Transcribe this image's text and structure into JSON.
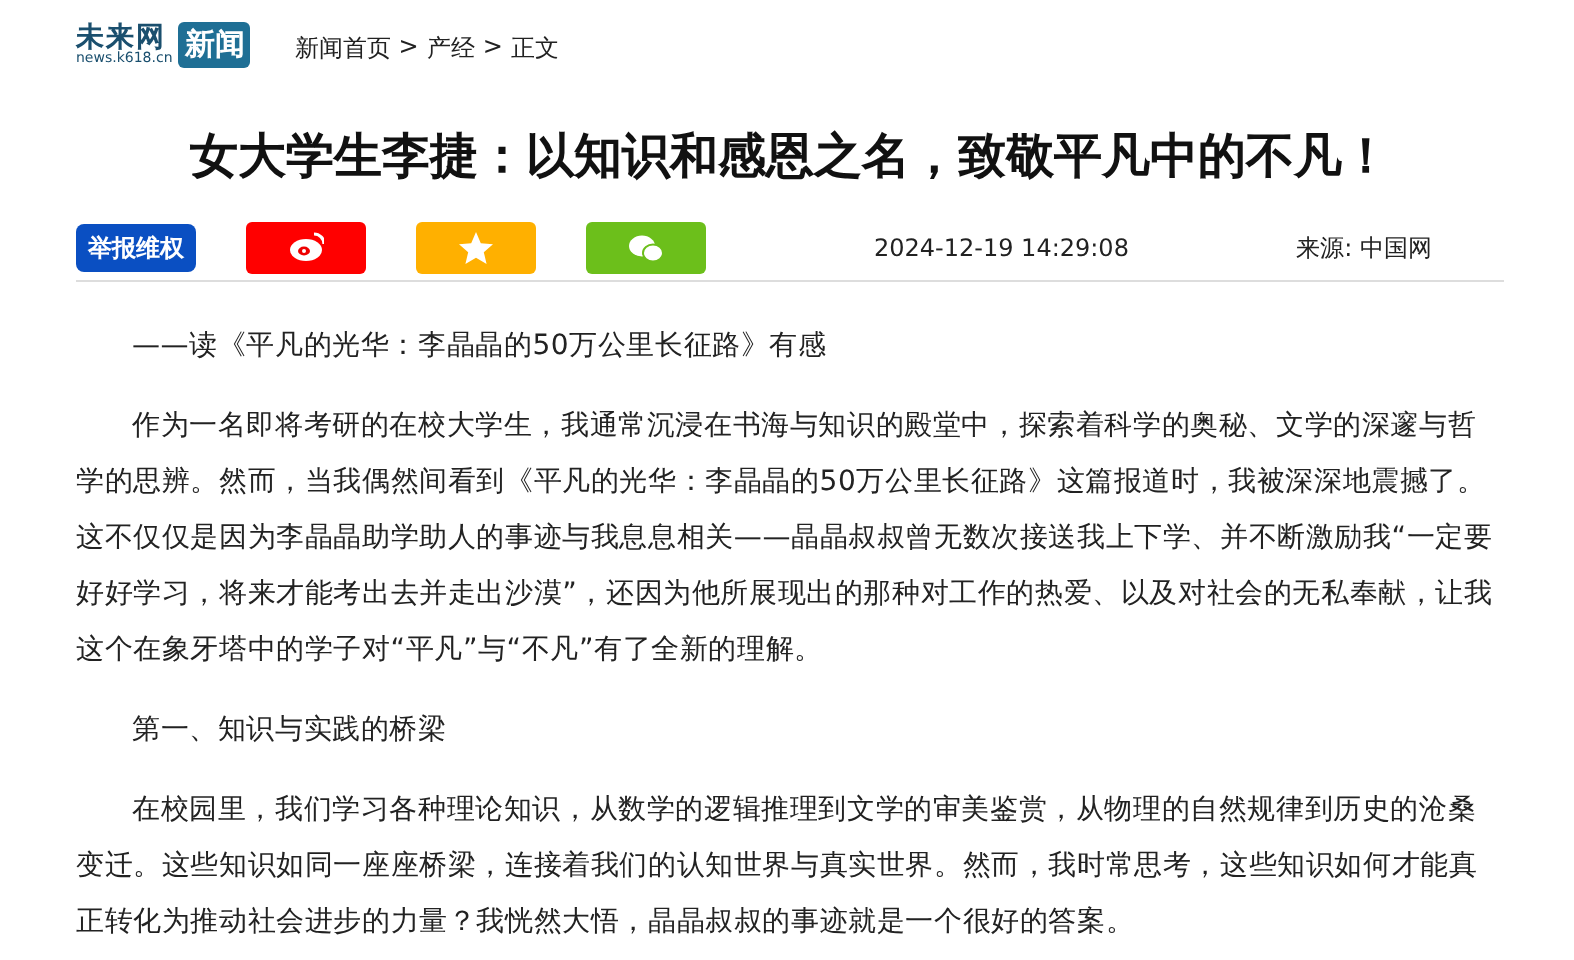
{
  "header": {
    "logo": {
      "name": "未来网",
      "domain": "news.k618.cn",
      "badge": "新闻"
    },
    "breadcrumb": [
      "新闻首页",
      ">",
      "产经",
      ">",
      "正文"
    ]
  },
  "article": {
    "title": "女大学生李捷：以知识和感恩之名，致敬平凡中的不凡！",
    "report_button": "举报维权",
    "share_buttons": [
      {
        "kind": "weibo",
        "color": "#ff0000"
      },
      {
        "kind": "favorite",
        "color": "#ffb000"
      },
      {
        "kind": "wechat",
        "color": "#6cbf1b"
      }
    ],
    "date": "2024-12-19 14:29:08",
    "source": "来源: 中国网",
    "paragraphs": [
      "——读《平凡的光华：李晶晶的50万公里长征路》有感",
      "作为一名即将考研的在校大学生，我通常沉浸在书海与知识的殿堂中，探索着科学的奥秘、文学的深邃与哲学的思辨。然而，当我偶然间看到《平凡的光华：李晶晶的50万公里长征路》这篇报道时，我被深深地震撼了。这不仅仅是因为李晶晶助学助人的事迹与我息息相关——晶晶叔叔曾无数次接送我上下学、并不断激励我“一定要好好学习，将来才能考出去并走出沙漠”，还因为他所展现出的那种对工作的热爱、以及对社会的无私奉献，让我这个在象牙塔中的学子对“平凡”与“不凡”有了全新的理解。",
      "第一、知识与实践的桥梁",
      "在校园里，我们学习各种理论知识，从数学的逻辑推理到文学的审美鉴赏，从物理的自然规律到历史的沧桑变迁。这些知识如同一座座桥梁，连接着我们的认知世界与真实世界。然而，我时常思考，这些知识如何才能真正转化为推动社会进步的力量？我恍然大悟，晶晶叔叔的事迹就是一个很好的答案。"
    ]
  }
}
